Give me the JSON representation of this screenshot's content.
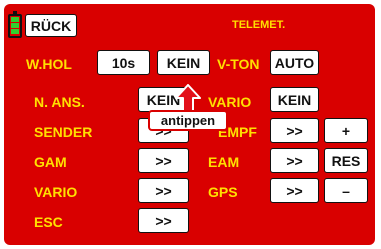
{
  "header": {
    "back_label": "RÜCK",
    "title": "TELEMET.",
    "battery_icon": "battery-icon"
  },
  "rows": {
    "whol_label": "W.HOL",
    "whol_value": "10s",
    "whol_mode": "KEIN",
    "vton_label": "V-TON",
    "vton_value": "AUTO",
    "nans_label": "N. ANS.",
    "nans_value": "KEIN",
    "vario_label": "VARIO",
    "vario_value": "KEIN",
    "sender_label": "SENDER",
    "sender_value": ">>",
    "empf_label": "EMPF",
    "empf_value": ">>",
    "plus_label": "+",
    "gam_label": "GAM",
    "gam_value": ">>",
    "eam_label": "EAM",
    "eam_value": ">>",
    "res_label": "RES",
    "vario2_label": "VARIO",
    "vario2_value": ">>",
    "gps_label": "GPS",
    "gps_value": ">>",
    "minus_label": "–",
    "esc_label": "ESC",
    "esc_value": ">>"
  },
  "callout": {
    "text": "antippen",
    "arrow_icon": "arrow-up-icon"
  },
  "colors": {
    "background": "#d90000",
    "label": "#ffe000",
    "button": "#ffffff"
  }
}
